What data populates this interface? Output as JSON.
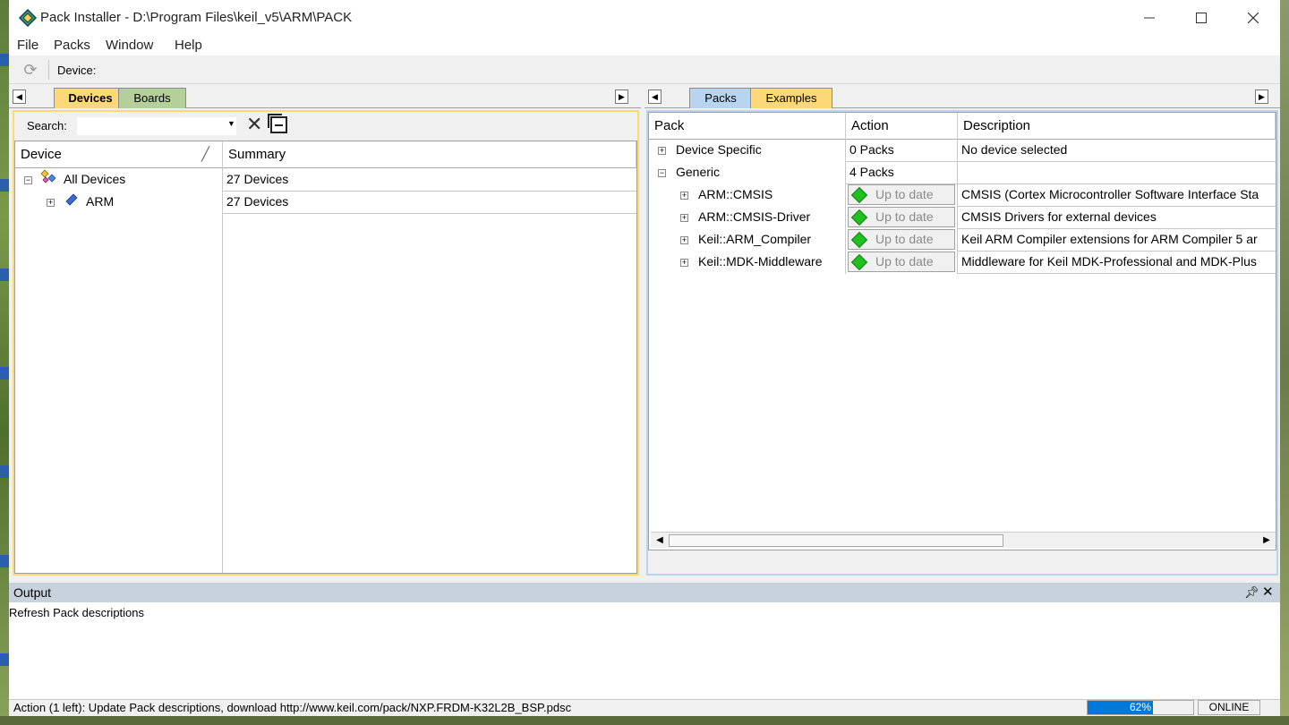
{
  "window": {
    "title": "Pack Installer - D:\\Program Files\\keil_v5\\ARM\\PACK"
  },
  "menu": [
    {
      "label": "File"
    },
    {
      "label": "Packs"
    },
    {
      "label": "Window"
    },
    {
      "label": "Help"
    }
  ],
  "toolbar": {
    "device_label": "Device:"
  },
  "left_panel": {
    "tabs": [
      {
        "label": "Devices",
        "active": true
      },
      {
        "label": "Boards",
        "active": false
      }
    ],
    "search": {
      "label": "Search:",
      "value": ""
    },
    "columns": [
      "Device",
      "Summary"
    ],
    "rows": [
      {
        "device": "All Devices",
        "summary": "27 Devices",
        "level": 0,
        "expanded": true
      },
      {
        "device": "ARM",
        "summary": "27 Devices",
        "level": 1,
        "expanded": false
      }
    ]
  },
  "right_panel": {
    "tabs": [
      {
        "label": "Packs",
        "active": true
      },
      {
        "label": "Examples",
        "active": false
      }
    ],
    "columns": [
      "Pack",
      "Action",
      "Description"
    ],
    "rows": [
      {
        "pack": "Device Specific",
        "action": "0 Packs",
        "description": "No device selected",
        "level": 0,
        "expanded": false,
        "button": false
      },
      {
        "pack": "Generic",
        "action": "4 Packs",
        "description": "",
        "level": 0,
        "expanded": true,
        "button": false
      },
      {
        "pack": "ARM::CMSIS",
        "action": "Up to date",
        "description": "CMSIS (Cortex Microcontroller Software Interface Sta",
        "level": 1,
        "expanded": false,
        "button": true
      },
      {
        "pack": "ARM::CMSIS-Driver",
        "action": "Up to date",
        "description": "CMSIS Drivers for external devices",
        "level": 1,
        "expanded": false,
        "button": true
      },
      {
        "pack": "Keil::ARM_Compiler",
        "action": "Up to date",
        "description": "Keil ARM Compiler extensions for ARM Compiler 5 ar",
        "level": 1,
        "expanded": false,
        "button": true
      },
      {
        "pack": "Keil::MDK-Middleware",
        "action": "Up to date",
        "description": "Middleware for Keil MDK-Professional and MDK-Plus",
        "level": 1,
        "expanded": false,
        "button": true
      }
    ]
  },
  "output": {
    "title": "Output",
    "lines": [
      "Refresh Pack descriptions"
    ]
  },
  "status": {
    "text": "Action (1 left): Update Pack descriptions, download http://www.keil.com/pack/NXP.FRDM-K32L2B_BSP.pdsc",
    "progress_label": "62%",
    "progress_value": 62,
    "online": "ONLINE"
  },
  "colors": {
    "tab_active_yellow": "#fcd878",
    "tab_inactive_green": "#b5cf9a",
    "tab_active_blue": "#b8d4ee",
    "up_to_date_icon": "#20c020",
    "output_header": "#c8d2dc"
  }
}
